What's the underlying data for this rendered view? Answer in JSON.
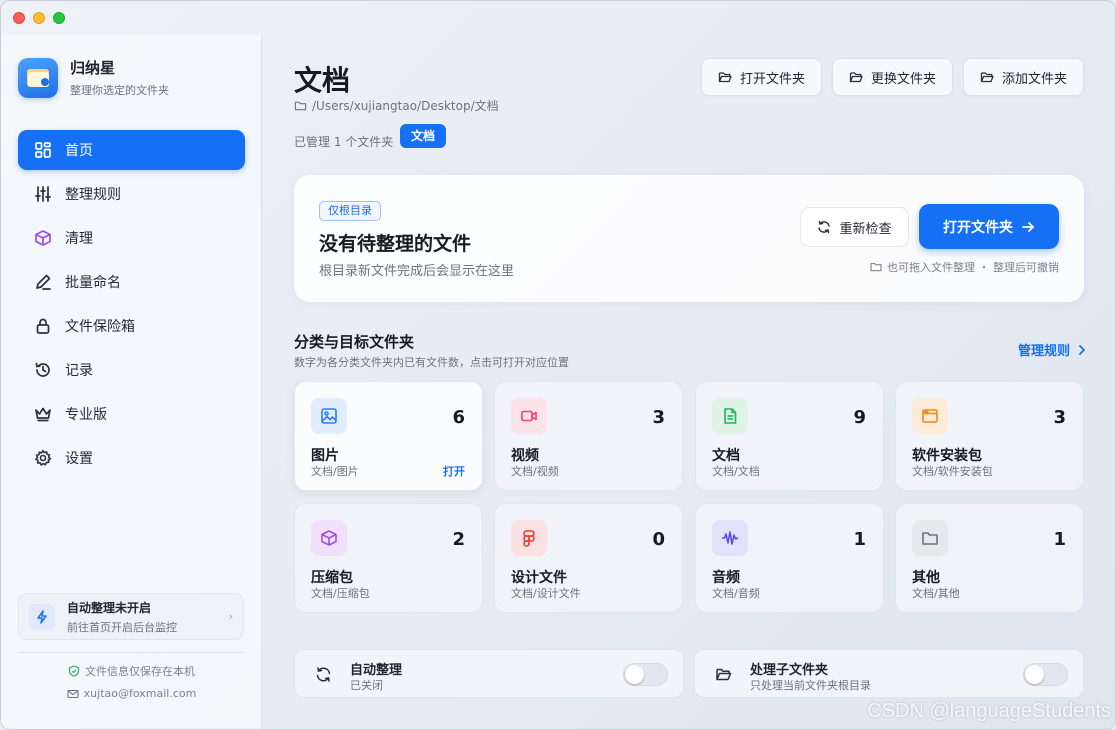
{
  "brand": {
    "name": "归纳星",
    "subtitle": "整理你选定的文件夹"
  },
  "nav": [
    {
      "label": "首页",
      "icon": "grid-icon",
      "active": true
    },
    {
      "label": "整理规则",
      "icon": "sliders-icon"
    },
    {
      "label": "清理",
      "icon": "box-icon"
    },
    {
      "label": "批量命名",
      "icon": "pen-icon"
    },
    {
      "label": "文件保险箱",
      "icon": "lock-icon"
    },
    {
      "label": "记录",
      "icon": "history-icon"
    },
    {
      "label": "专业版",
      "icon": "crown-icon"
    },
    {
      "label": "设置",
      "icon": "gear-icon"
    }
  ],
  "sidebar_status": {
    "title": "自动整理未开启",
    "subtitle": "前往首页开启后台监控"
  },
  "sidebar_footer": {
    "privacy": "文件信息仅保存在本机",
    "email": "xujtao@foxmail.com"
  },
  "header": {
    "title": "文档",
    "path": "/Users/xujiangtao/Desktop/文档",
    "managed_text": "已管理 1 个文件夹",
    "folder_chip": "文档"
  },
  "toolbar": {
    "open_folder": "打开文件夹",
    "change_folder": "更换文件夹",
    "add_folder": "添加文件夹"
  },
  "status_card": {
    "tag": "仅根目录",
    "title": "没有待整理的文件",
    "subtitle": "根目录新文件完成后会显示在这里",
    "recheck": "重新检查",
    "open_folder": "打开文件夹",
    "hint": "也可拖入文件整理 ・ 整理后可撤销"
  },
  "categories_section": {
    "title": "分类与目标文件夹",
    "subtitle": "数字为各分类文件夹内已有文件数，点击可打开对应位置",
    "manage_link": "管理规则"
  },
  "categories": [
    {
      "name": "图片",
      "path": "文档/图片",
      "count": "6",
      "icon": "image-icon",
      "color": "#2f7cf6",
      "bg": "#e2edfd",
      "open_label": "打开"
    },
    {
      "name": "视频",
      "path": "文档/视频",
      "count": "3",
      "icon": "video-icon",
      "color": "#ef3e6b",
      "bg": "#fbe3ea"
    },
    {
      "name": "文档",
      "path": "文档/文档",
      "count": "9",
      "icon": "document-icon",
      "color": "#22b358",
      "bg": "#def4e6"
    },
    {
      "name": "软件安装包",
      "path": "文档/软件安装包",
      "count": "3",
      "icon": "installer-icon",
      "color": "#f08a1c",
      "bg": "#fcebd9"
    },
    {
      "name": "压缩包",
      "path": "文档/压缩包",
      "count": "2",
      "icon": "archive-icon",
      "color": "#a24ee8",
      "bg": "#efe1fb"
    },
    {
      "name": "设计文件",
      "path": "文档/设计文件",
      "count": "0",
      "icon": "figma-icon",
      "color": "#ee3a3a",
      "bg": "#fbe1e1"
    },
    {
      "name": "音频",
      "path": "文档/音频",
      "count": "1",
      "icon": "audio-icon",
      "color": "#5b4ee8",
      "bg": "#e4e2fb"
    },
    {
      "name": "其他",
      "path": "文档/其他",
      "count": "1",
      "icon": "folder-icon",
      "color": "#6b7280",
      "bg": "#e6e8ec"
    }
  ],
  "settings": {
    "auto": {
      "title": "自动整理",
      "subtitle": "已关闭",
      "enabled": false
    },
    "subfolders": {
      "title": "处理子文件夹",
      "subtitle": "只处理当前文件夹根目录",
      "enabled": false
    }
  },
  "watermark": "CSDN @languageStudents"
}
